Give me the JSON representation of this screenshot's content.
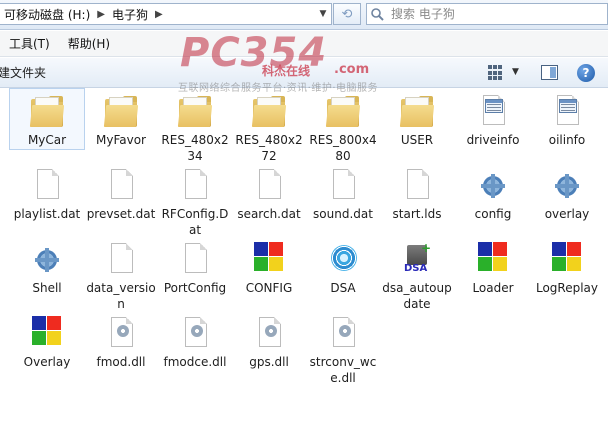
{
  "address": {
    "crumbs": [
      "可移动磁盘 (H:)",
      "电子狗"
    ],
    "search_placeholder": "搜索 电子狗"
  },
  "menu": [
    "工具(T)",
    "帮助(H)"
  ],
  "toolbar": {
    "new_folder_label": "建文件夹",
    "help_label": "?"
  },
  "files": [
    {
      "name": "MyCar",
      "type": "folder",
      "selected": true
    },
    {
      "name": "MyFavor",
      "type": "folder"
    },
    {
      "name": "RES_480x234",
      "type": "folder"
    },
    {
      "name": "RES_480x272",
      "type": "folder"
    },
    {
      "name": "RES_800x480",
      "type": "folder"
    },
    {
      "name": "USER",
      "type": "folder"
    },
    {
      "name": "driveinfo",
      "type": "ini"
    },
    {
      "name": "oilinfo",
      "type": "ini"
    },
    {
      "name": "playlist.dat",
      "type": "blank"
    },
    {
      "name": "prevset.dat",
      "type": "blank"
    },
    {
      "name": "RFConfig.Dat",
      "type": "blank"
    },
    {
      "name": "search.dat",
      "type": "blank"
    },
    {
      "name": "sound.dat",
      "type": "blank"
    },
    {
      "name": "start.lds",
      "type": "blank"
    },
    {
      "name": "config",
      "type": "settings"
    },
    {
      "name": "overlay",
      "type": "settings"
    },
    {
      "name": "Shell",
      "type": "settings"
    },
    {
      "name": "data_version",
      "type": "blank"
    },
    {
      "name": "PortConfig",
      "type": "blank"
    },
    {
      "name": "CONFIG",
      "type": "exe"
    },
    {
      "name": "DSA",
      "type": "dsa"
    },
    {
      "name": "dsa_autoupdate",
      "type": "dsa-package"
    },
    {
      "name": "Loader",
      "type": "exe"
    },
    {
      "name": "LogReplay",
      "type": "exe"
    },
    {
      "name": "Overlay",
      "type": "exe"
    },
    {
      "name": "fmod.dll",
      "type": "dll"
    },
    {
      "name": "fmodce.dll",
      "type": "dll"
    },
    {
      "name": "gps.dll",
      "type": "dll"
    },
    {
      "name": "strconv_wce.dll",
      "type": "dll"
    }
  ],
  "watermark": {
    "logo": "PC354",
    "tag": "科杰在线",
    "com": ".com",
    "subtitle": "互联网络综合服务平台·资讯·维护·电脑服务"
  }
}
